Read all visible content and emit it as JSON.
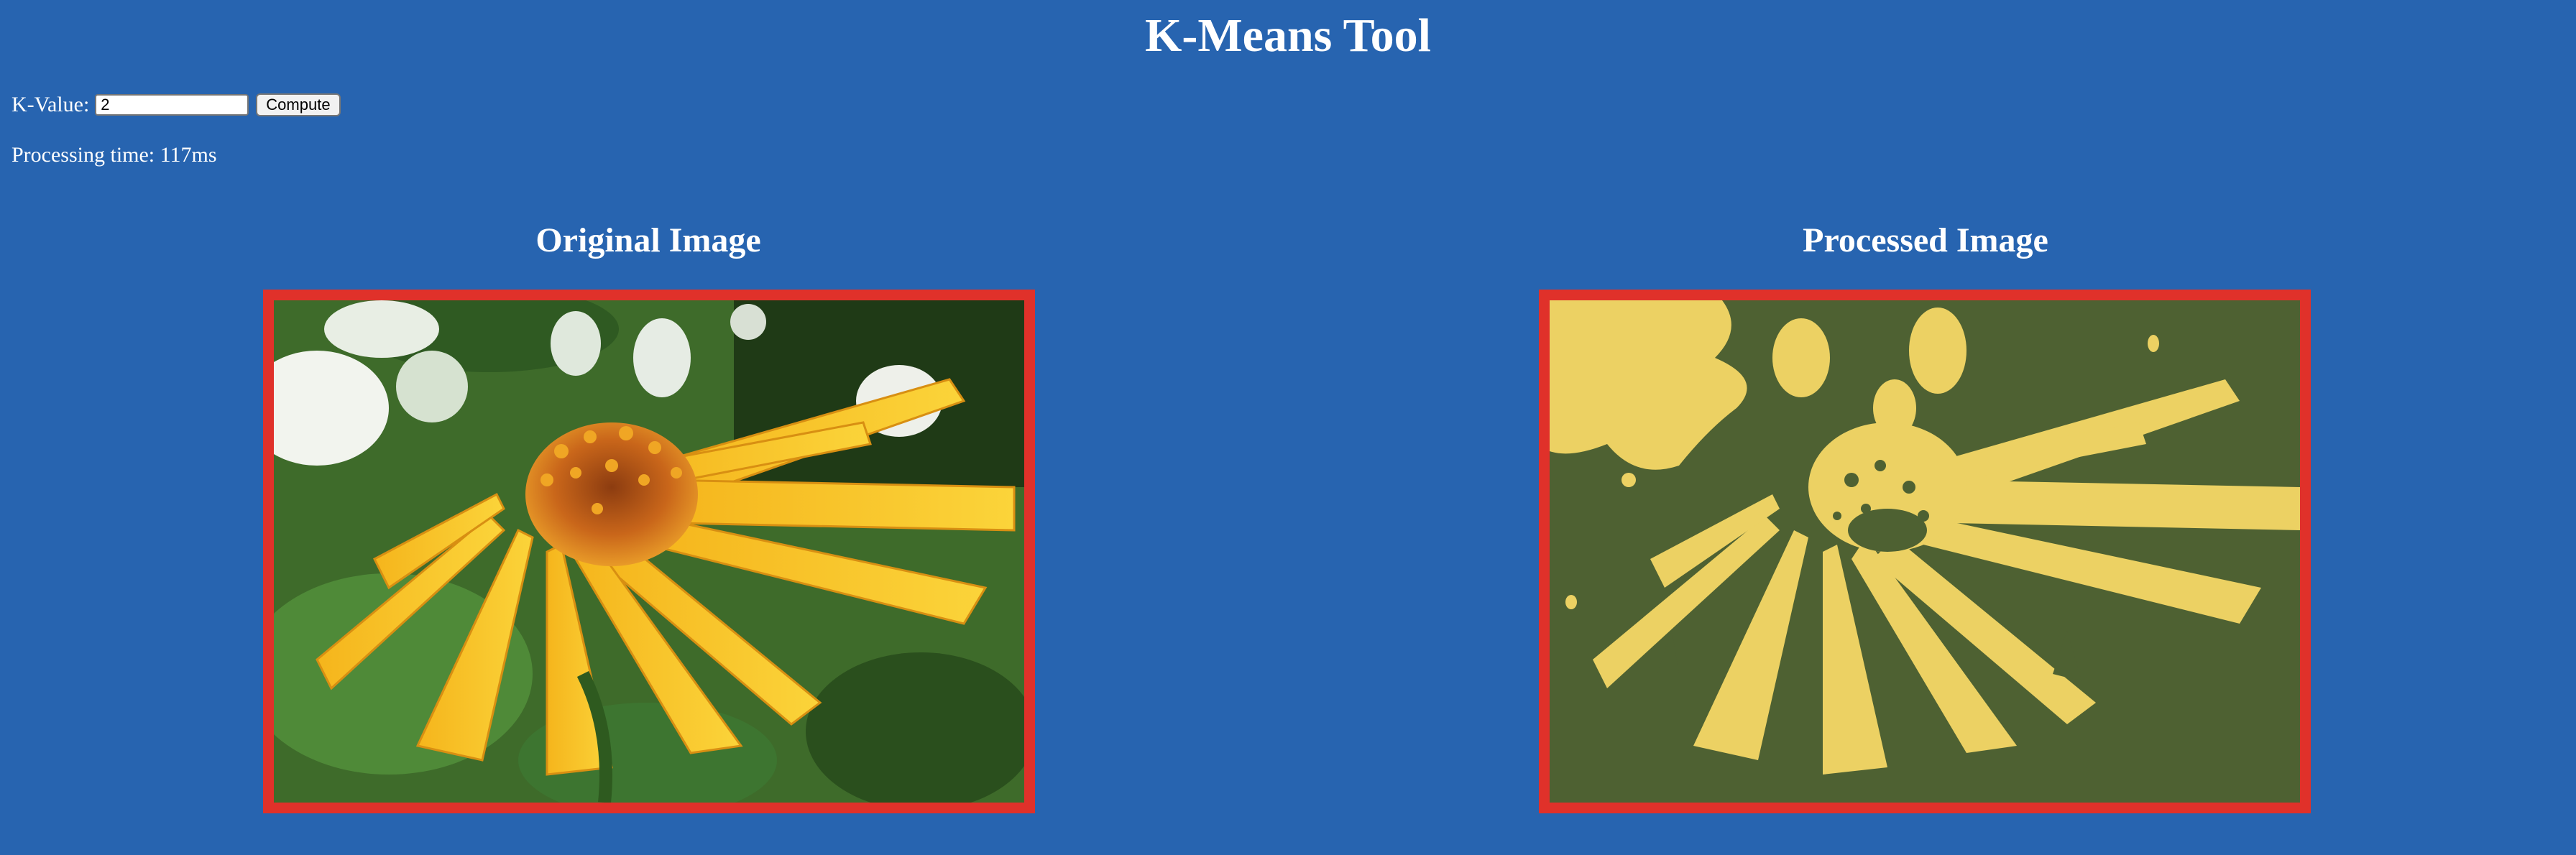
{
  "page": {
    "title": "K-Means Tool"
  },
  "controls": {
    "k_label": "K-Value:",
    "k_value": "2",
    "compute_label": "Compute"
  },
  "status": {
    "processing_time": "Processing time: 117ms"
  },
  "panels": {
    "original": {
      "heading": "Original Image"
    },
    "processed": {
      "heading": "Processed Image"
    }
  },
  "colors": {
    "background": "#2764b0",
    "frame_border": "#e0312a",
    "cluster_dark": "#4e6132",
    "cluster_light": "#ecd163"
  }
}
